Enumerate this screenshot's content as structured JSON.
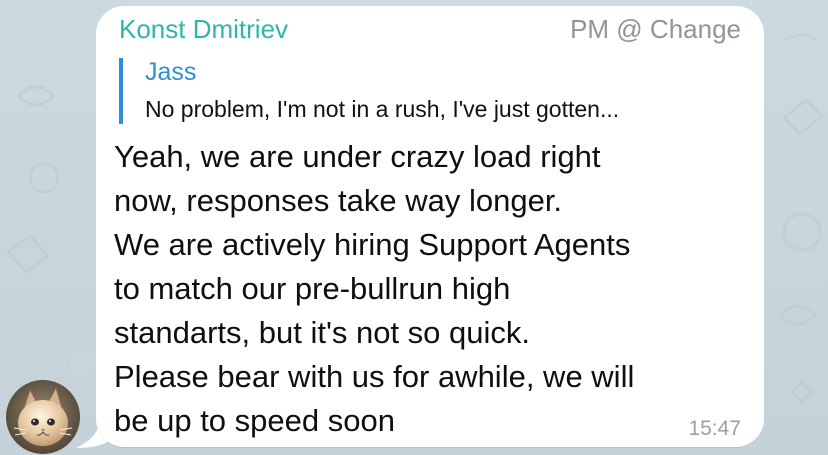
{
  "chat": {
    "message": {
      "sender_name": "Konst Dmitriev",
      "header_right": "PM @ Change",
      "reply": {
        "author": "Jass",
        "preview": "No problem, I'm not in a rush, I've just gotten..."
      },
      "lines": [
        "Yeah, we are under crazy load right",
        "now, responses take way longer.",
        "We are actively hiring Support Agents",
        "to match our pre-bullrun high",
        "standarts, but it's not so quick.",
        "Please bear with us for awhile, we will",
        "be up to speed soon"
      ],
      "time": "15:47"
    },
    "avatar_icon": "cat-avatar",
    "colors": {
      "sender_name": "#2fb7a5",
      "reply_accent": "#2d8fd5",
      "meta_text": "#8e959b",
      "bubble": "#ffffff",
      "background": "#c9d6de"
    }
  }
}
